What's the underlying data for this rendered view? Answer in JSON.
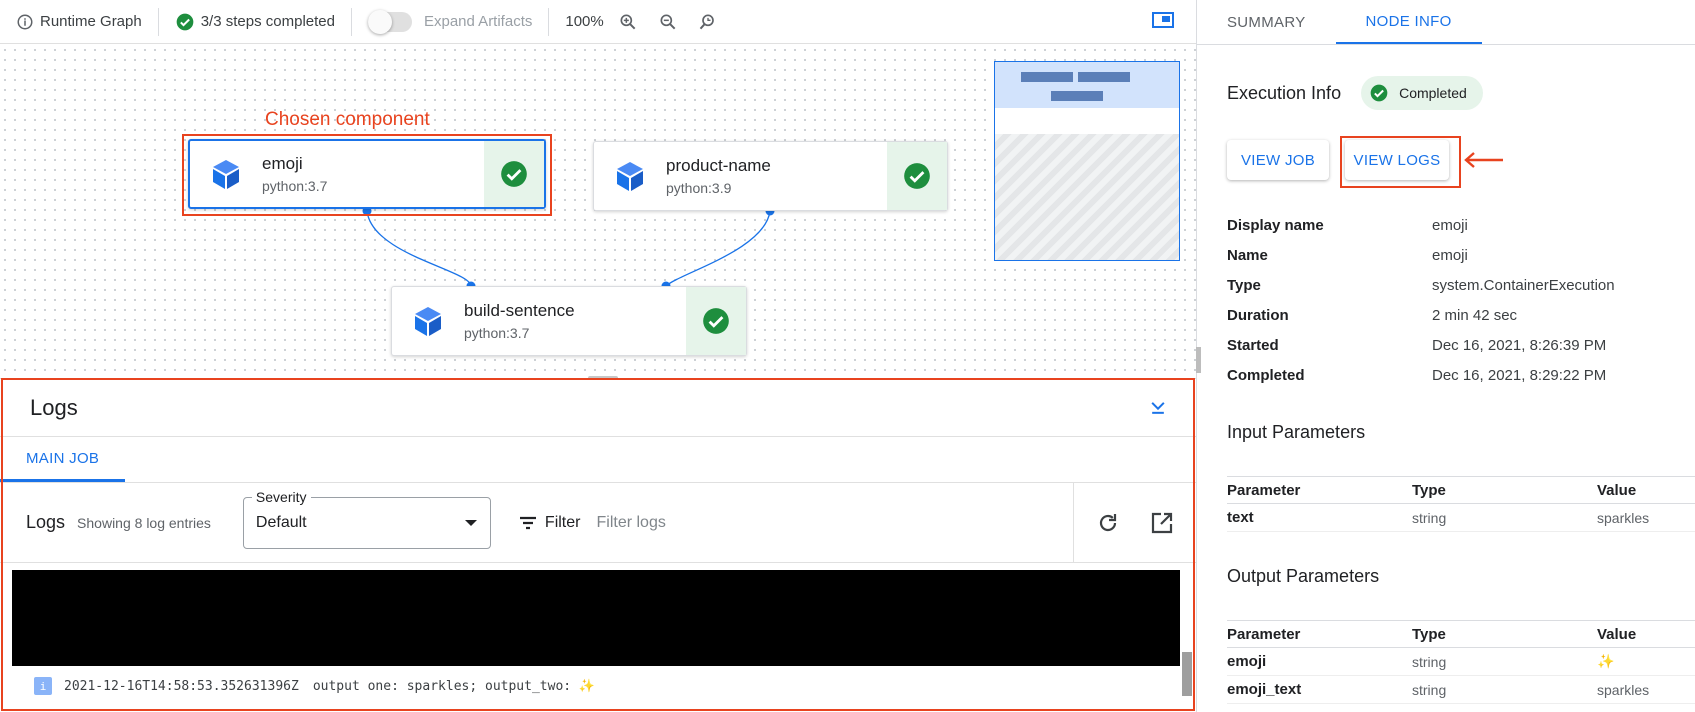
{
  "toolbar": {
    "runtime_graph": "Runtime Graph",
    "steps": "3/3 steps completed",
    "expand_artifacts": "Expand Artifacts",
    "zoom": "100%"
  },
  "graph": {
    "annotation": "Chosen component",
    "nodes": [
      {
        "title": "emoji",
        "image": "python:3.7"
      },
      {
        "title": "product-name",
        "image": "python:3.9"
      },
      {
        "title": "build-sentence",
        "image": "python:3.7"
      }
    ]
  },
  "logs": {
    "title": "Logs",
    "tab": "MAIN JOB",
    "label": "Logs",
    "count": "Showing 8 log entries",
    "severity_label": "Severity",
    "severity_value": "Default",
    "filter_label": "Filter",
    "filter_placeholder": "Filter logs",
    "entry": {
      "severity_glyph": "i",
      "timestamp": "2021-12-16T14:58:53.352631396Z",
      "message": "output one: sparkles; output_two: ✨"
    }
  },
  "panel": {
    "tabs": [
      "SUMMARY",
      "NODE INFO"
    ],
    "exec_title": "Execution Info",
    "status": "Completed",
    "view_job": "VIEW JOB",
    "view_logs": "VIEW LOGS",
    "info": [
      {
        "key": "Display name",
        "value": "emoji"
      },
      {
        "key": "Name",
        "value": "emoji"
      },
      {
        "key": "Type",
        "value": "system.ContainerExecution"
      },
      {
        "key": "Duration",
        "value": "2 min 42 sec"
      },
      {
        "key": "Started",
        "value": "Dec 16, 2021, 8:26:39 PM"
      },
      {
        "key": "Completed",
        "value": "Dec 16, 2021, 8:29:22 PM"
      }
    ],
    "input_title": "Input Parameters",
    "output_title": "Output Parameters",
    "param_headers": [
      "Parameter",
      "Type",
      "Value"
    ],
    "inputs": [
      {
        "name": "text",
        "type": "string",
        "value": "sparkles"
      }
    ],
    "outputs": [
      {
        "name": "emoji",
        "type": "string",
        "value": "✨"
      },
      {
        "name": "emoji_text",
        "type": "string",
        "value": "sparkles"
      }
    ]
  },
  "colors": {
    "accent": "#1a73e8",
    "success": "#1e8e3e",
    "success_bg": "#e6f4ea",
    "annotation": "#e8431f"
  }
}
